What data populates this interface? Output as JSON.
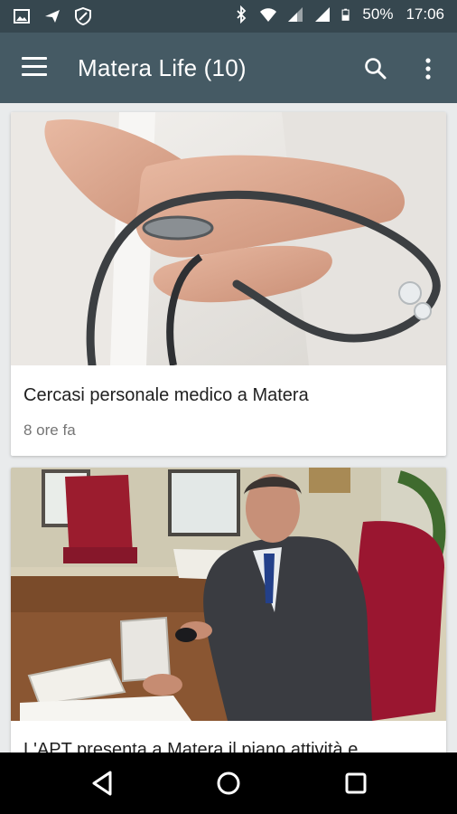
{
  "status_bar": {
    "battery": "50%",
    "time": "17:06",
    "left_icons": [
      "image-icon",
      "send-icon",
      "shield-icon"
    ],
    "right_icons": [
      "bluetooth-icon",
      "wifi-icon",
      "signal-icon",
      "signal-icon",
      "battery-icon"
    ]
  },
  "app_bar": {
    "title": "Matera Life (10)",
    "background": "#455a64",
    "status_background": "#36474f"
  },
  "articles": [
    {
      "title": "Cercasi personale medico a Matera",
      "time": "8 ore fa",
      "image": "doctor-stethoscope-photo"
    },
    {
      "title": "L'APT presenta a Matera il piano attività e",
      "image": "man-at-desk-photo"
    }
  ],
  "nav_bar": {
    "buttons": [
      "back-icon",
      "home-icon",
      "recents-icon"
    ]
  }
}
